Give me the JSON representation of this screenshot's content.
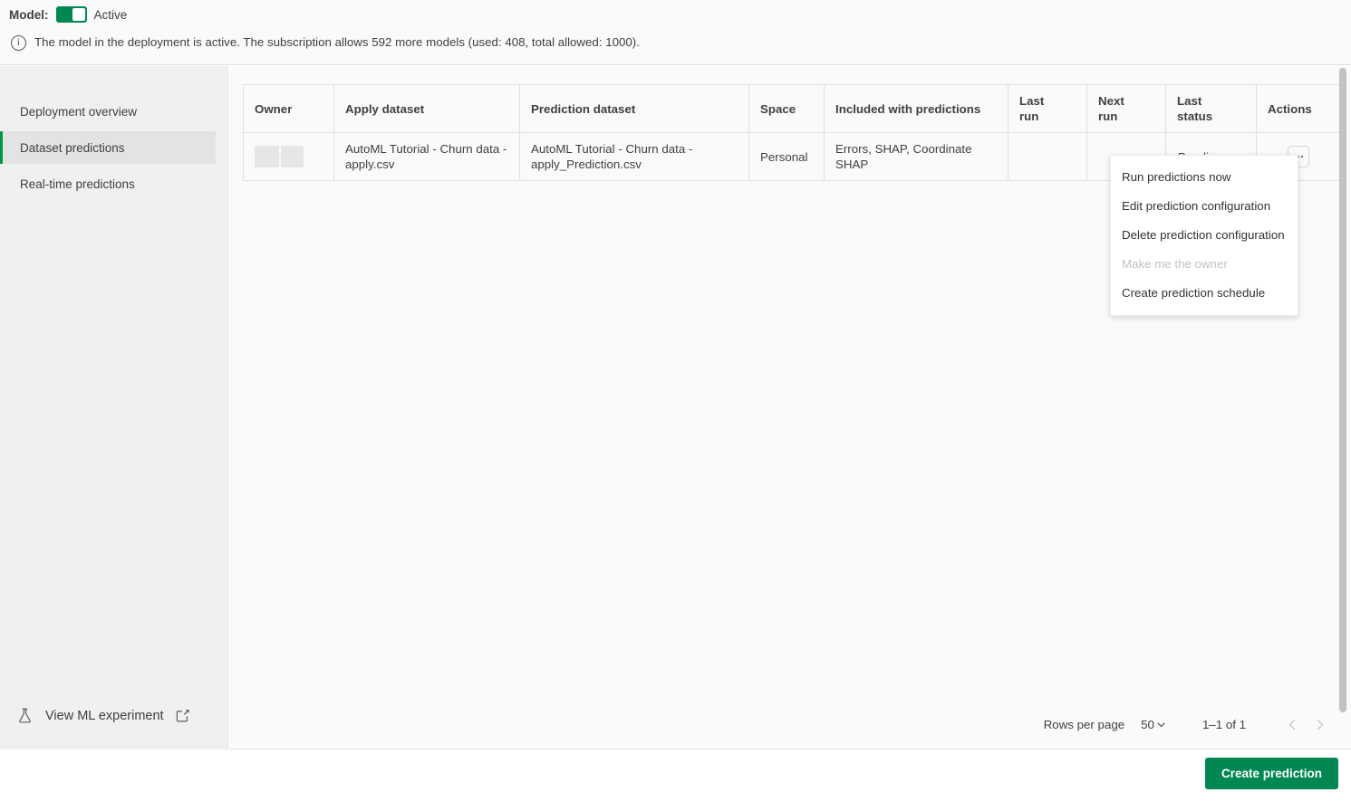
{
  "topbar": {
    "model_label": "Model:",
    "toggle_state": "on",
    "model_state": "Active",
    "info_icon": "info-circle-icon",
    "info_text": "The model in the deployment is active. The subscription allows 592 more models (used: 408, total allowed: 1000).",
    "accent_green": "#008752"
  },
  "sidebar": {
    "items": [
      {
        "label": "Deployment overview",
        "active": false
      },
      {
        "label": "Dataset predictions",
        "active": true
      },
      {
        "label": "Real-time predictions",
        "active": false
      }
    ],
    "ml_link": {
      "label": "View ML experiment",
      "leading_icon": "flask-icon",
      "trailing_icon": "external-link-icon"
    }
  },
  "table": {
    "columns": [
      {
        "key": "owner",
        "label": "Owner"
      },
      {
        "key": "apply",
        "label": "Apply dataset"
      },
      {
        "key": "pred",
        "label": "Prediction dataset"
      },
      {
        "key": "space",
        "label": "Space"
      },
      {
        "key": "incl",
        "label": "Included with predictions"
      },
      {
        "key": "lastrun",
        "label_line1": "Last",
        "label_line2": "run"
      },
      {
        "key": "nextrun",
        "label_line1": "Next",
        "label_line2": "run"
      },
      {
        "key": "status",
        "label_line1": "Last",
        "label_line2": "status"
      },
      {
        "key": "actions",
        "label": "Actions"
      }
    ],
    "rows": [
      {
        "owner": "",
        "owner_redacted": true,
        "apply": "AutoML Tutorial - Churn data - apply.csv",
        "pred": "AutoML Tutorial - Churn data - apply_Prediction.csv",
        "space": "Personal",
        "incl": "Errors, SHAP, Coordinate SHAP",
        "lastrun": "",
        "nextrun": "",
        "status": "Pending",
        "actions_icon": "kebab-menu-icon"
      }
    ]
  },
  "actions_menu": {
    "open": true,
    "items": [
      {
        "label": "Run predictions now",
        "disabled": false
      },
      {
        "label": "Edit prediction configuration",
        "disabled": false
      },
      {
        "label": "Delete prediction configuration",
        "disabled": false
      },
      {
        "label": "Make me the owner",
        "disabled": true
      },
      {
        "label": "Create prediction schedule",
        "disabled": false
      }
    ]
  },
  "pagination": {
    "rows_per_page_label": "Rows per page",
    "rows_per_page_value": "50",
    "range_label": "1–1 of 1",
    "prev_icon": "chevron-left-icon",
    "next_icon": "chevron-right-icon"
  },
  "bottombar": {
    "create_button": "Create prediction"
  }
}
